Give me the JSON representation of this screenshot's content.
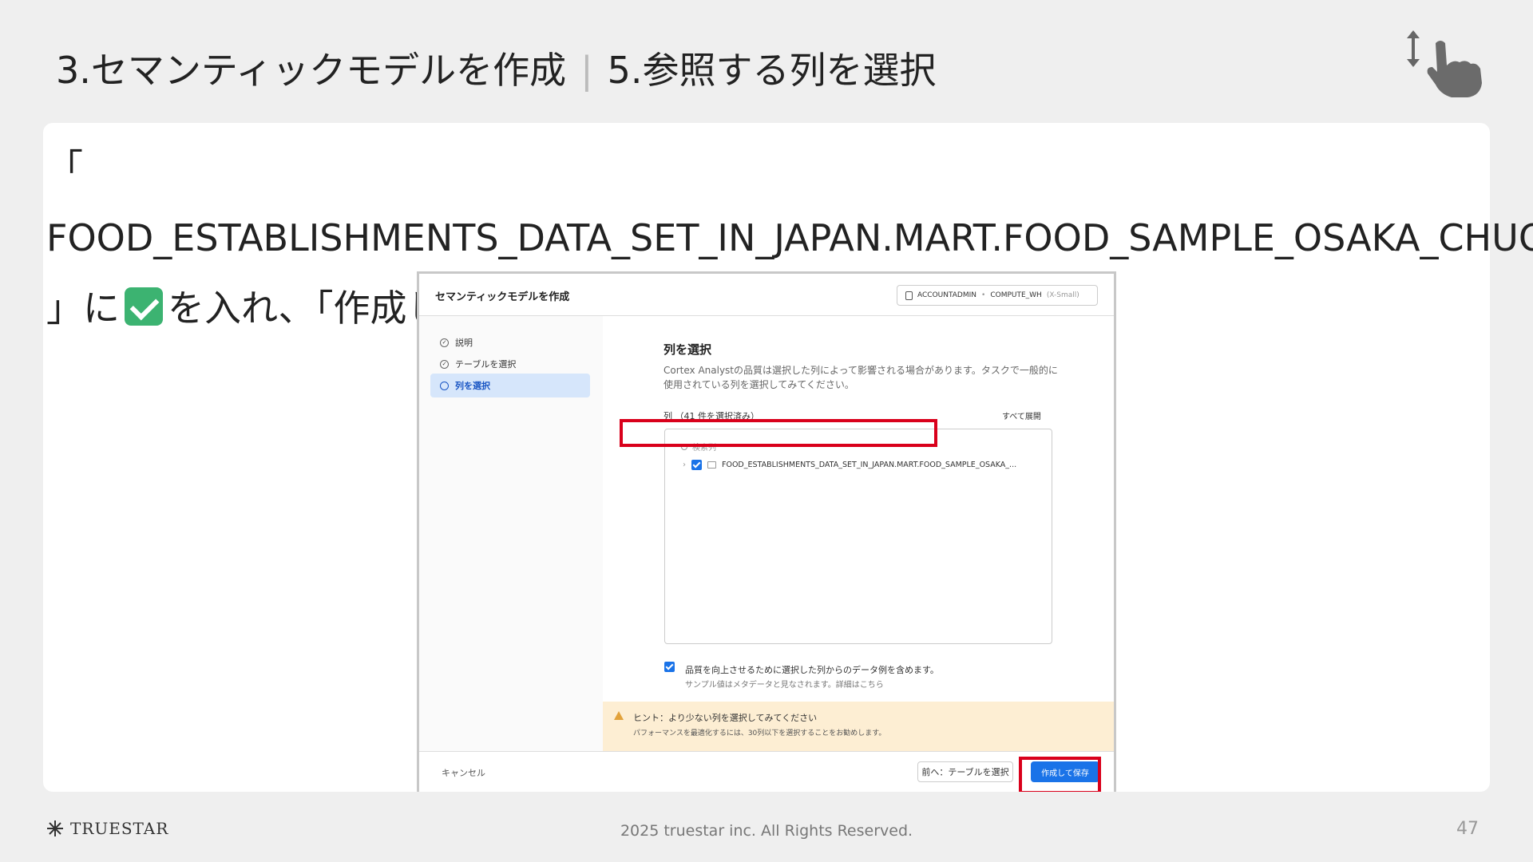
{
  "slide": {
    "title_left": "3.セマンティックモデルを作成",
    "title_separator": "|",
    "title_right": "5.参照する列を選択",
    "instruction_part1": "「 FOOD_ESTABLISHMENTS_DATA_SET_IN_JAPAN.MART.FOOD_SAMPLE_OSAKA_CHUO 」に",
    "instruction_part2": "を入れ、「作成して保存」をクリック",
    "check_emoji_icon": "check-mark-button-icon",
    "copyright": "2025 truestar inc. All Rights Reserved.",
    "page_number": "47",
    "logo_text": "TRUESTAR",
    "highlight_color": "#d9001b"
  },
  "screenshot": {
    "window_title": "セマンティックモデルを作成",
    "role": "ACCOUNTADMIN",
    "warehouse": "COMPUTE_WH",
    "warehouse_size": "(X-Small)",
    "steps": [
      {
        "label": "説明",
        "state": "done"
      },
      {
        "label": "テーブルを選択",
        "state": "done"
      },
      {
        "label": "列を選択",
        "state": "active"
      }
    ],
    "main_title": "列を選択",
    "description": "Cortex Analystの品質は選択した列によって影響される場合があります。タスクで一般的に使用されている列を選択してみてください。",
    "columns_label": "列 （41 件を選択済み）",
    "expand_all": "すべて展開",
    "search_placeholder": "検索列",
    "table_name": "FOOD_ESTABLISHMENTS_DATA_SET_IN_JAPAN.MART.FOOD_SAMPLE_OSAKA_...",
    "sample_option_label": "品質を向上させるために選択した列からのデータ例を含めます。",
    "sample_option_sub": "サンプル値はメタデータと見なされます。詳細はこちら",
    "hint_title": "ヒント：より少ない列を選択してみてください",
    "hint_body": "パフォーマンスを最適化するには、30列以下を選択することをお勧めします。",
    "cancel_label": "キャンセル",
    "prev_label": "前へ：テーブルを選択",
    "save_label": "作成して保存",
    "accent_color": "#1a73e8"
  }
}
